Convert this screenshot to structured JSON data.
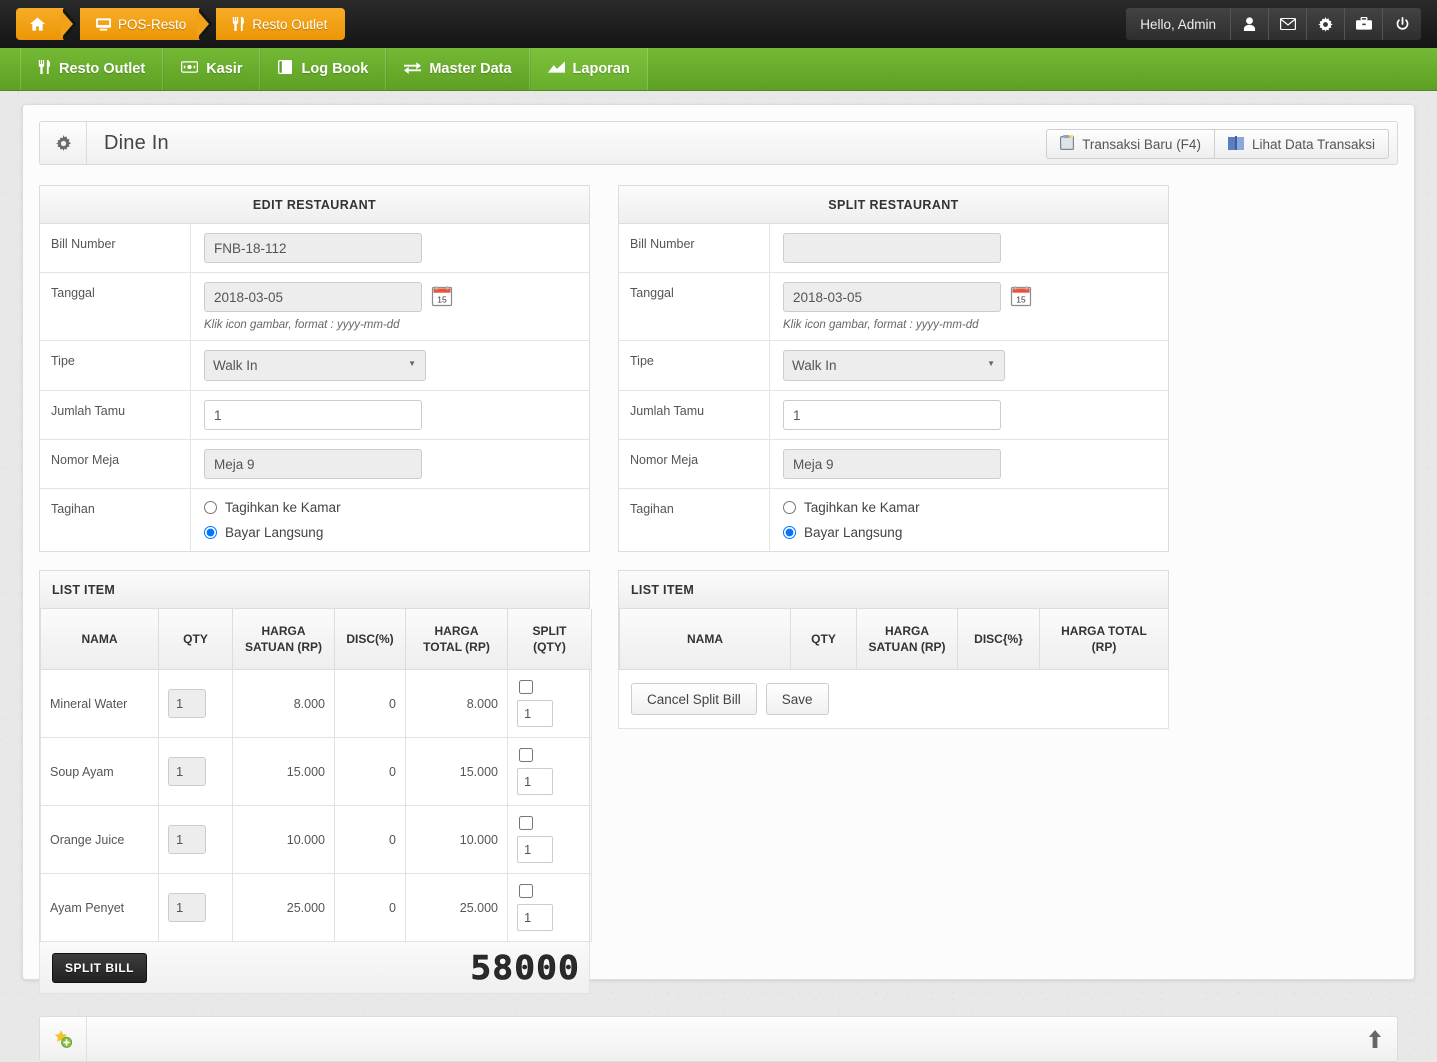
{
  "topbar": {
    "breadcrumb": [
      {
        "label": "",
        "icon": "home-icon"
      },
      {
        "label": "POS-Resto",
        "icon": "monitor-icon"
      },
      {
        "label": "Resto Outlet",
        "icon": "cutlery-icon"
      }
    ],
    "greeting": "Hello, Admin",
    "user_buttons": [
      {
        "name": "user-icon",
        "glyph": "P"
      },
      {
        "name": "envelope-icon",
        "glyph": "P"
      },
      {
        "name": "gear-icon",
        "glyph": "P"
      },
      {
        "name": "briefcase-icon",
        "glyph": "P"
      },
      {
        "name": "power-icon",
        "glyph": "P"
      }
    ]
  },
  "nav": {
    "items": [
      {
        "label": "Resto Outlet",
        "icon": "cutlery-icon",
        "active": false
      },
      {
        "label": "Kasir",
        "icon": "cash-register-icon",
        "active": false
      },
      {
        "label": "Log Book",
        "icon": "book-icon",
        "active": false
      },
      {
        "label": "Master Data",
        "icon": "exchange-icon",
        "active": false
      },
      {
        "label": "Laporan",
        "icon": "chart-icon",
        "active": true
      }
    ]
  },
  "page": {
    "title": "Dine In",
    "title_icon": "gear-icon",
    "actions": [
      {
        "label": "Transaksi Baru (F4)",
        "icon": "clipboard-icon"
      },
      {
        "label": "Lihat Data Transaksi",
        "icon": "book-open-icon"
      }
    ]
  },
  "edit_panel": {
    "heading": "EDIT RESTAURANT",
    "fields": {
      "bill_number_label": "Bill Number",
      "bill_number_value": "FNB-18-112",
      "tanggal_label": "Tanggal",
      "tanggal_value": "2018-03-05",
      "tanggal_hint": "Klik icon gambar, format : yyyy-mm-dd",
      "calendar_day": "15",
      "tipe_label": "Tipe",
      "tipe_value": "Walk In",
      "tipe_options": [
        "Walk In"
      ],
      "jumlah_tamu_label": "Jumlah Tamu",
      "jumlah_tamu_value": "1",
      "nomor_meja_label": "Nomor Meja",
      "nomor_meja_value": "Meja 9",
      "tagihan_label": "Tagihan",
      "tagihan_option_1": "Tagihkan ke Kamar",
      "tagihan_option_2": "Bayar Langsung",
      "tagihan_selected": "Bayar Langsung"
    }
  },
  "split_panel": {
    "heading": "SPLIT RESTAURANT",
    "fields": {
      "bill_number_label": "Bill Number",
      "bill_number_value": "",
      "tanggal_label": "Tanggal",
      "tanggal_value": "2018-03-05",
      "tanggal_hint": "Klik icon gambar, format : yyyy-mm-dd",
      "calendar_day": "15",
      "tipe_label": "Tipe",
      "tipe_value": "Walk In",
      "tipe_options": [
        "Walk In"
      ],
      "jumlah_tamu_label": "Jumlah Tamu",
      "jumlah_tamu_value": "1",
      "nomor_meja_label": "Nomor Meja",
      "nomor_meja_value": "Meja 9",
      "tagihan_label": "Tagihan",
      "tagihan_option_1": "Tagihkan ke Kamar",
      "tagihan_option_2": "Bayar Langsung",
      "tagihan_selected": "Bayar Langsung"
    }
  },
  "left_list": {
    "heading": "LIST ITEM",
    "columns": [
      "NAMA",
      "QTY",
      "HARGA SATUAN (RP)",
      "DISC(%)",
      "HARGA TOTAL (RP)",
      "SPLIT (QTY)"
    ],
    "columns_line1": [
      "NAMA",
      "QTY",
      "HARGA",
      "DISC(%)",
      "HARGA",
      "SPLIT"
    ],
    "columns_line2": [
      "",
      "",
      "SATUAN (RP)",
      "",
      "TOTAL (RP)",
      "(QTY)"
    ],
    "rows": [
      {
        "nama": "Mineral Water",
        "qty": "1",
        "harga_satuan": "8.000",
        "disc": "0",
        "harga_total": "8.000",
        "split_checked": false,
        "split_qty": "1"
      },
      {
        "nama": "Soup Ayam",
        "qty": "1",
        "harga_satuan": "15.000",
        "disc": "0",
        "harga_total": "15.000",
        "split_checked": false,
        "split_qty": "1"
      },
      {
        "nama": "Orange Juice",
        "qty": "1",
        "harga_satuan": "10.000",
        "disc": "0",
        "harga_total": "10.000",
        "split_checked": false,
        "split_qty": "1"
      },
      {
        "nama": "Ayam Penyet",
        "qty": "1",
        "harga_satuan": "25.000",
        "disc": "0",
        "harga_total": "25.000",
        "split_checked": false,
        "split_qty": "1"
      }
    ],
    "split_bill_button": "SPLIT BILL",
    "grand_total": "58000"
  },
  "right_list": {
    "heading": "LIST ITEM",
    "columns_line1": [
      "NAMA",
      "QTY",
      "HARGA",
      "DISC{%}",
      "HARGA TOTAL"
    ],
    "columns_line2": [
      "",
      "",
      "SATUAN (RP)",
      "",
      "(RP)"
    ],
    "rows": [],
    "buttons": [
      {
        "label": "Cancel Split Bill",
        "name": "cancel-split-bill-button"
      },
      {
        "label": "Save",
        "name": "save-button"
      }
    ]
  },
  "footer": {
    "left_icon": "star-add-icon",
    "right_icon": "scroll-up-arrow-icon"
  },
  "colors": {
    "breadcrumb_orange": "#f2a11a",
    "nav_green": "#69ad2b",
    "topbar_black": "#1c1c1c",
    "page_bg": "#e8e8e8"
  }
}
